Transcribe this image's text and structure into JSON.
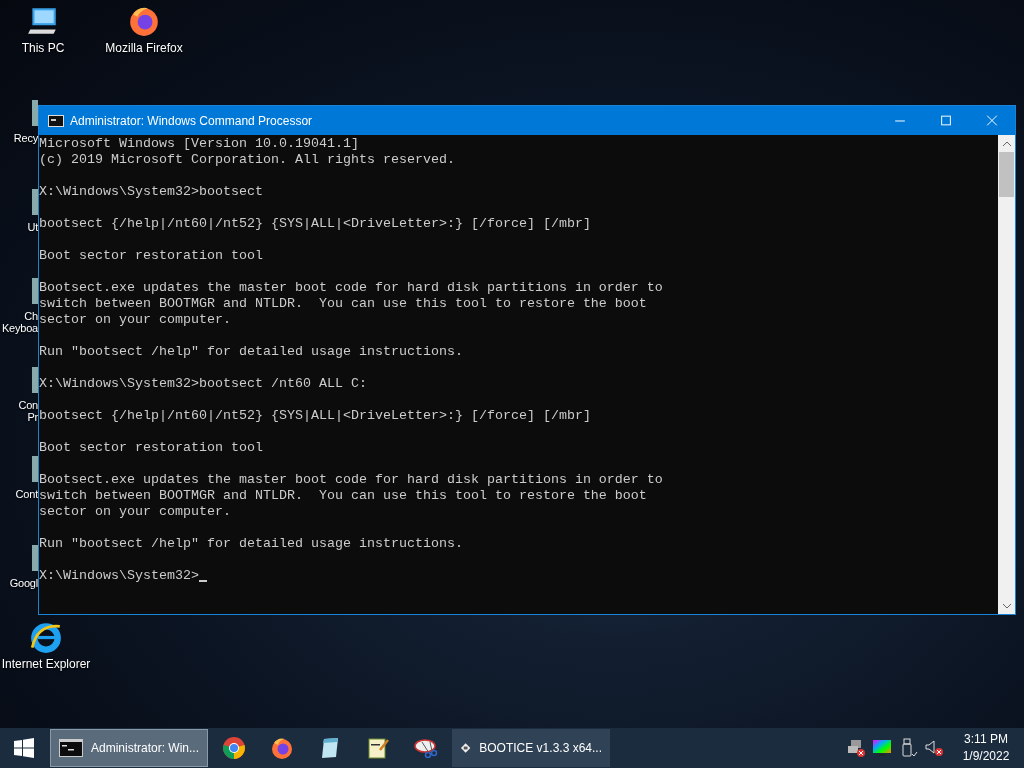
{
  "desktop_icons": [
    {
      "kind": "pc",
      "label": [
        "This PC"
      ]
    },
    {
      "kind": "firefox",
      "label": [
        "Mozilla Firefox"
      ]
    },
    {
      "kind": "ie",
      "label": [
        "Internet Explorer"
      ]
    }
  ],
  "covered_icons": [
    {
      "label": [
        "Recy"
      ]
    },
    {
      "label": [
        "Ut"
      ]
    },
    {
      "label": [
        "Ch",
        "Keyboa"
      ]
    },
    {
      "label": [
        "Con",
        "Pr"
      ]
    },
    {
      "label": [
        "Cont"
      ]
    },
    {
      "label": [
        "Googl"
      ]
    }
  ],
  "window": {
    "title": "Administrator: Windows Command Processor",
    "cursor": true,
    "paragraphs": [
      [
        "Microsoft Windows [Version 10.0.19041.1]",
        "(c) 2019 Microsoft Corporation. All rights reserved."
      ],
      [
        "X:\\Windows\\System32>bootsect"
      ],
      [
        "bootsect {/help|/nt60|/nt52} {SYS|ALL|<DriveLetter>:} [/force] [/mbr]"
      ],
      [
        "Boot sector restoration tool"
      ],
      [
        "Bootsect.exe updates the master boot code for hard disk partitions in order to",
        "switch between BOOTMGR and NTLDR.  You can use this tool to restore the boot",
        "sector on your computer."
      ],
      [
        "Run \"bootsect /help\" for detailed usage instructions."
      ],
      [
        "X:\\Windows\\System32>bootsect /nt60 ALL C:"
      ],
      [
        "bootsect {/help|/nt60|/nt52} {SYS|ALL|<DriveLetter>:} [/force] [/mbr]"
      ],
      [
        "Boot sector restoration tool"
      ],
      [
        "Bootsect.exe updates the master boot code for hard disk partitions in order to",
        "switch between BOOTMGR and NTLDR.  You can use this tool to restore the boot",
        "sector on your computer."
      ],
      [
        "Run \"bootsect /help\" for detailed usage instructions."
      ],
      [
        "X:\\Windows\\System32>"
      ]
    ]
  },
  "taskbar": {
    "items": [
      {
        "kind": "cmd",
        "label": "Administrator: Win...",
        "selected": true
      },
      {
        "kind": "chrome",
        "selected": false
      },
      {
        "kind": "firefox",
        "selected": false
      },
      {
        "kind": "notepad",
        "selected": false
      },
      {
        "kind": "editor",
        "selected": false
      },
      {
        "kind": "snip",
        "selected": false
      },
      {
        "kind": "bootice",
        "label": "BOOTICE v1.3.3 x64...",
        "selected": false
      }
    ],
    "time": "3:11 PM",
    "date": "1/9/2022"
  }
}
